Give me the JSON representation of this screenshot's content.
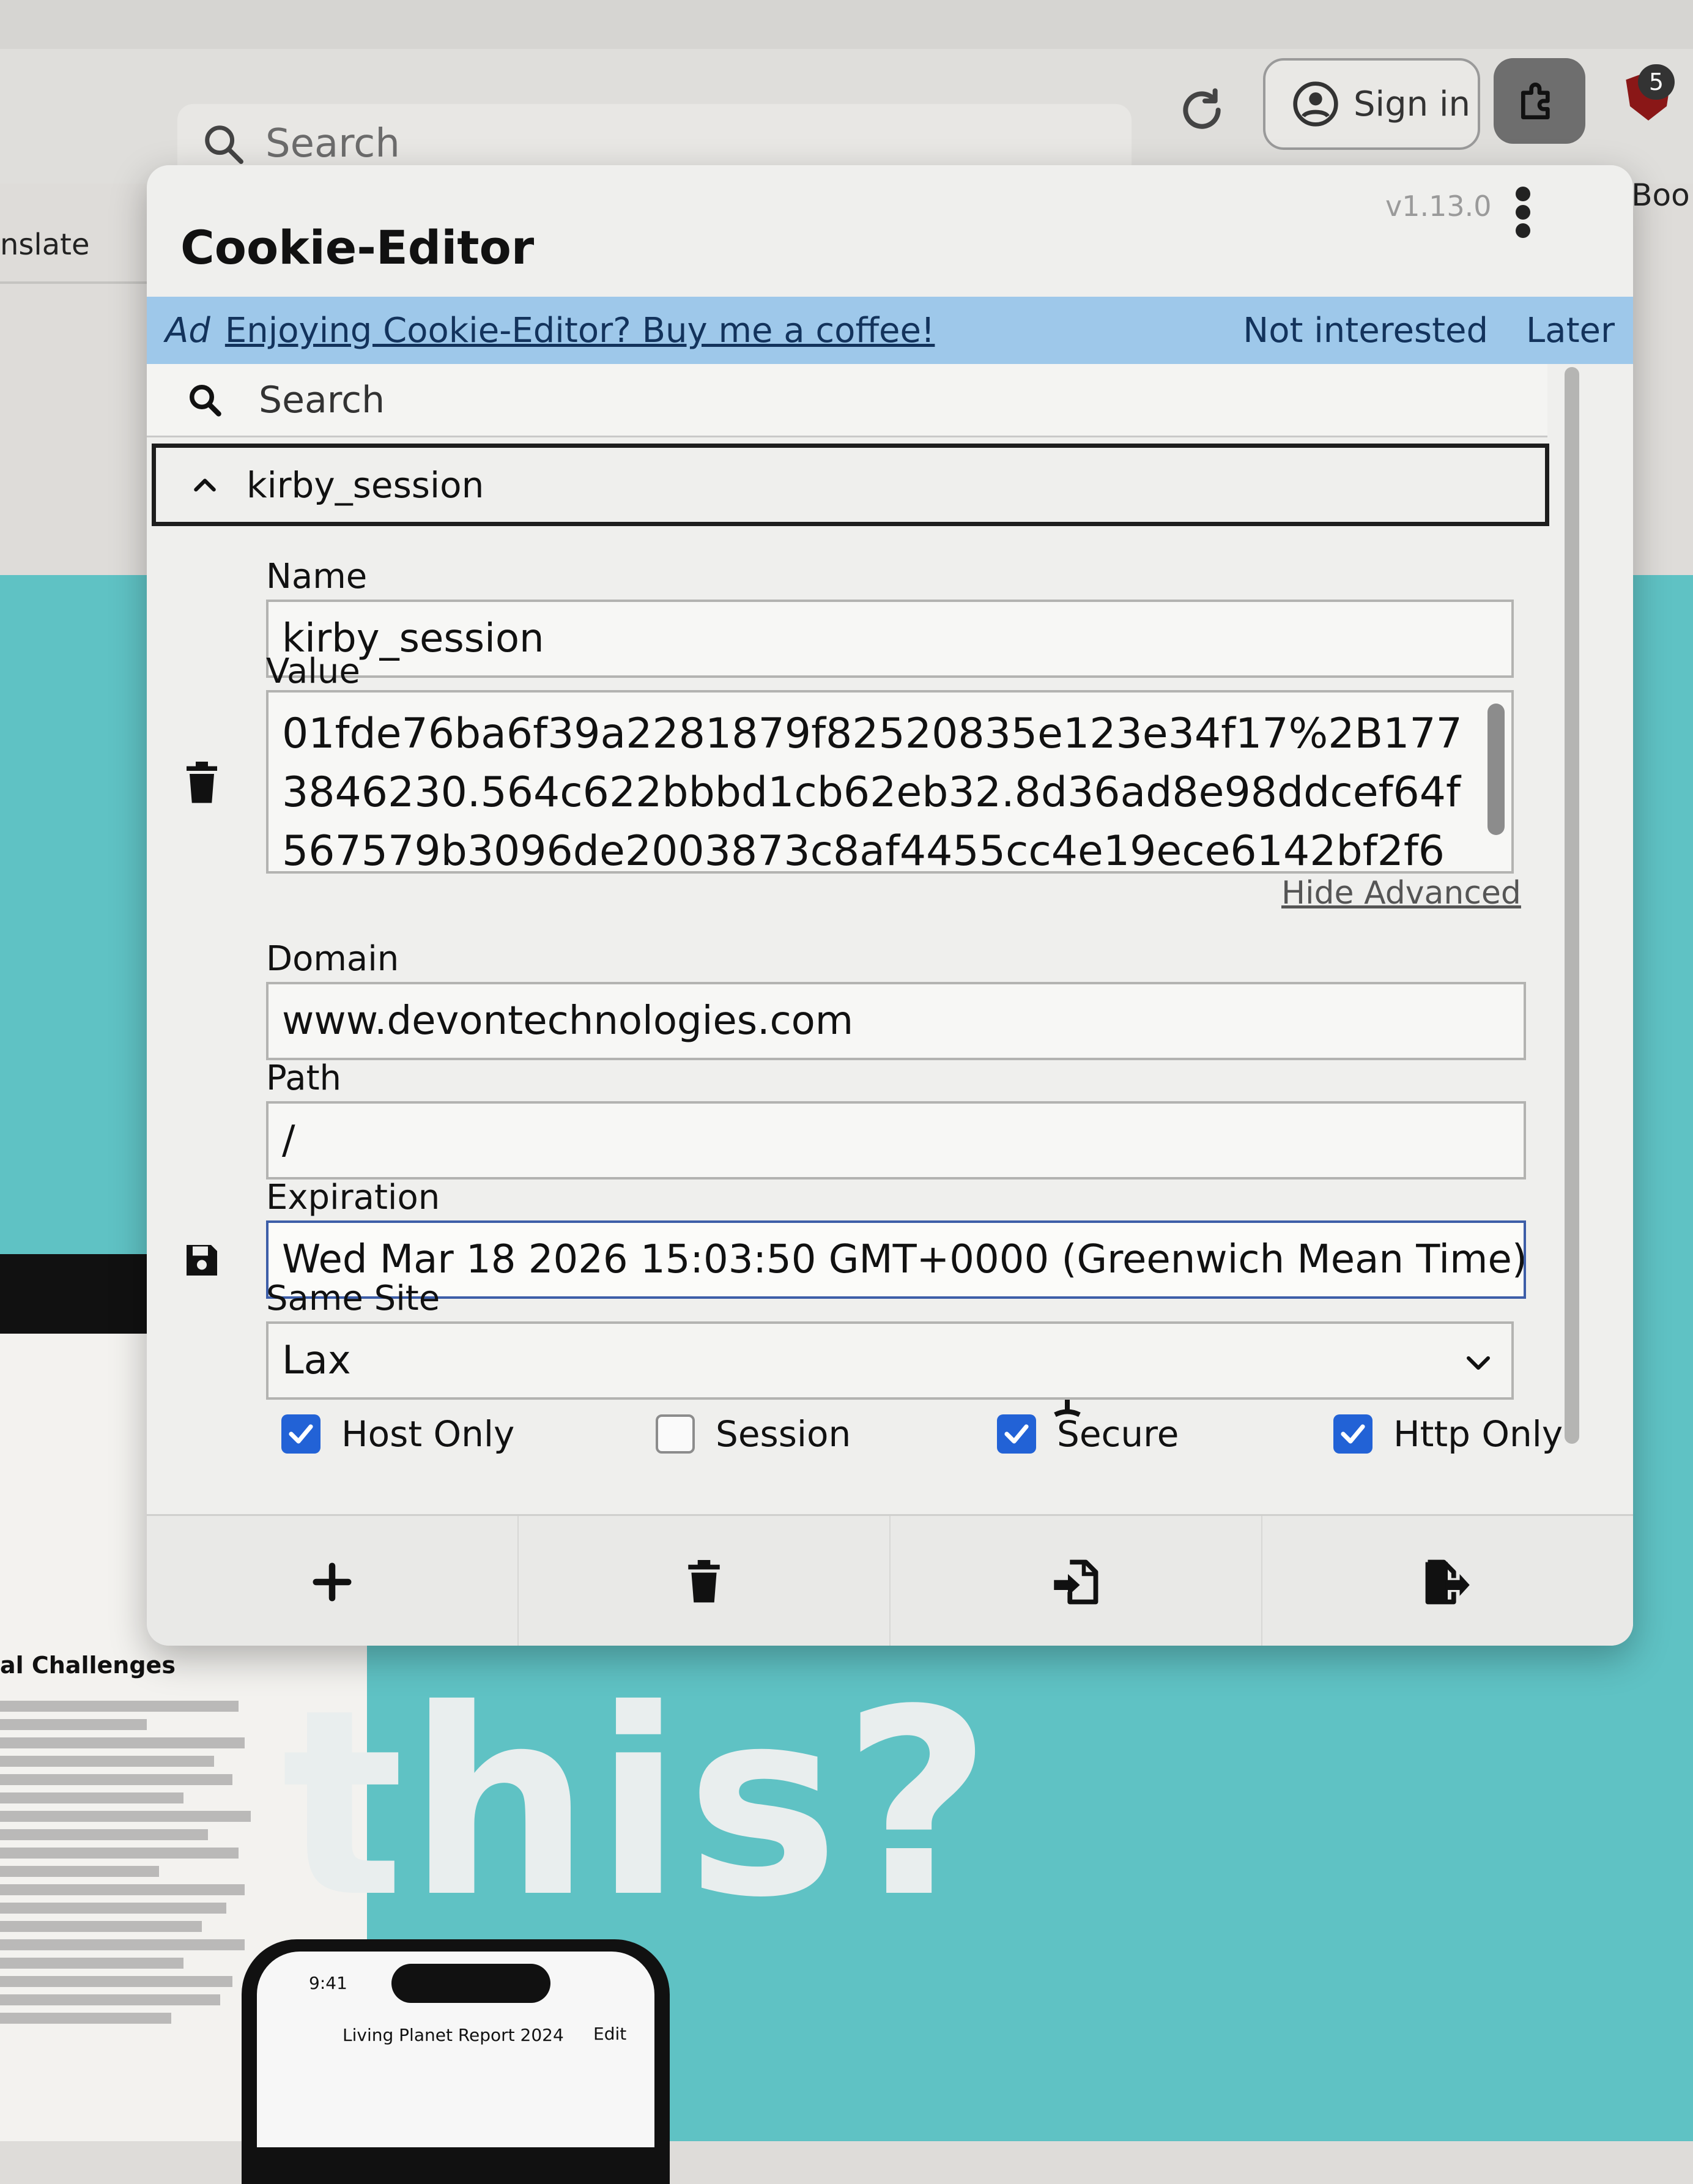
{
  "browser": {
    "search_placeholder": "Search",
    "sign_in_label": "Sign in",
    "extension_badge_count": "5",
    "left_tab_fragment": "nslate",
    "right_tab_fragment": "er Boo"
  },
  "popup": {
    "title": "Cookie-Editor",
    "version": "v1.13.0",
    "ad": {
      "tag": "Ad",
      "message": "Enjoying Cookie-Editor? Buy me a coffee!",
      "not_interested": "Not interested",
      "later": "Later"
    },
    "search_placeholder": "Search",
    "cookie": {
      "header_name": "kirby_session",
      "name_label": "Name",
      "name_value": "kirby_session",
      "value_label": "Value",
      "value_value": "01fde76ba6f39a2281879f82520835e123e34f17%2B1773846230.564c622bbbd1cb62eb32.8d36ad8e98ddcef64f567579b3096de2003873c8af4455cc4e19ece6142bf2f6",
      "hide_advanced": "Hide Advanced",
      "domain_label": "Domain",
      "domain_value": "www.devontechnologies.com",
      "path_label": "Path",
      "path_value": "/",
      "expiration_label": "Expiration",
      "expiration_value": "Wed Mar 18 2026 15:03:50 GMT+0000 (Greenwich Mean Time)",
      "same_site_label": "Same Site",
      "same_site_value": "Lax",
      "flags": {
        "host_only_label": "Host Only",
        "session_label": "Session",
        "secure_label": "Secure",
        "http_only_label": "Http Only"
      }
    }
  },
  "background": {
    "doc_heading": "al Challenges",
    "big_text": "this?",
    "phone_time": "9:41",
    "phone_title": "Living Planet Report 2024",
    "phone_edit": "Edit"
  },
  "colors": {
    "accent_blue": "#2262d6",
    "ad_banner": "#9ec8ea",
    "teal_background": "#5fc2c4"
  }
}
